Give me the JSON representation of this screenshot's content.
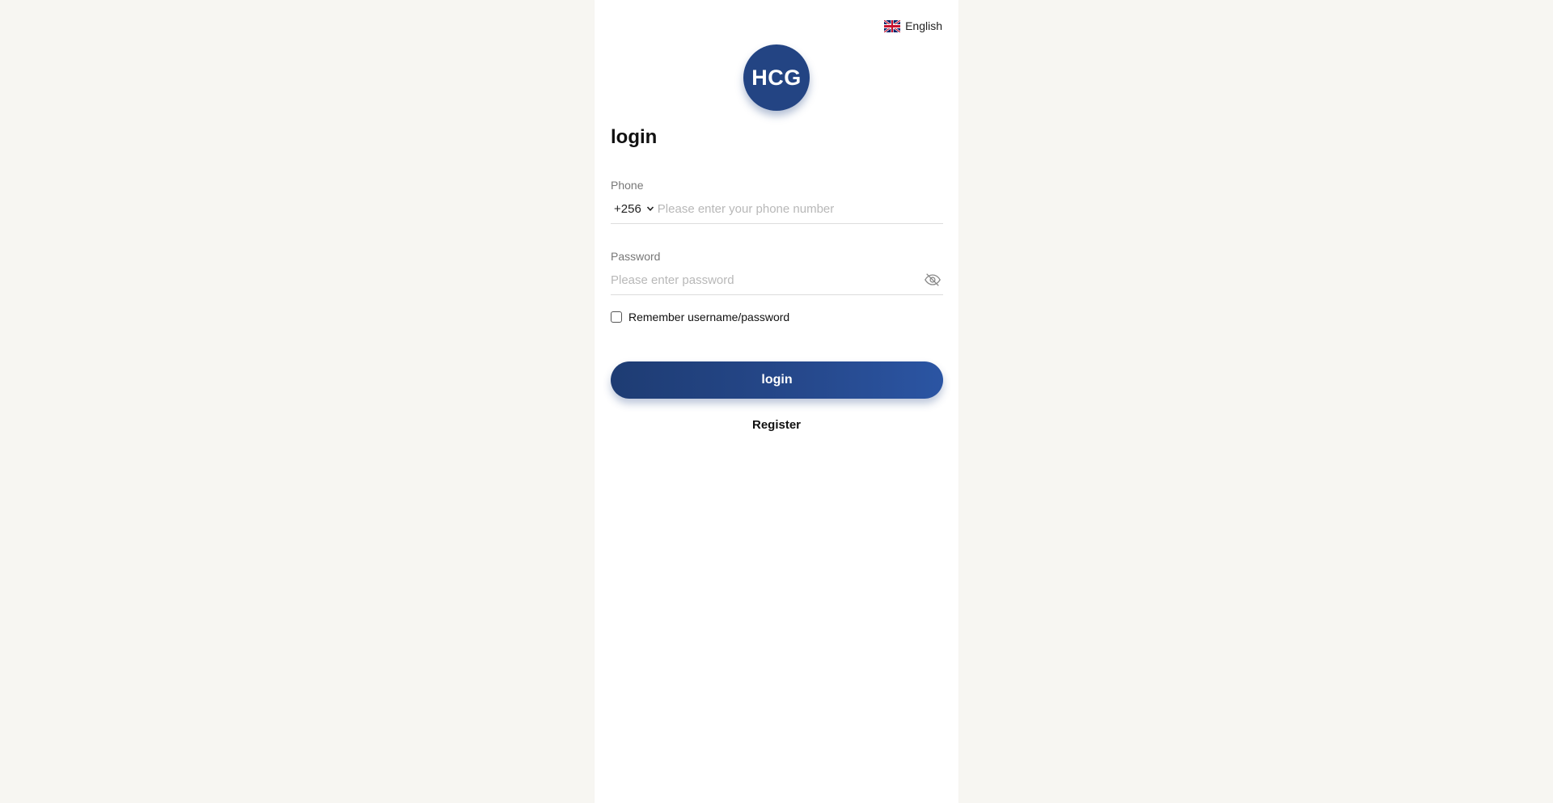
{
  "language": {
    "label": "English",
    "flag_icon": "uk-flag-icon"
  },
  "logo": {
    "text": "HCG",
    "color": "#234483"
  },
  "title": "login",
  "phone": {
    "label": "Phone",
    "country_code": "+256",
    "placeholder": "Please enter your phone number",
    "value": ""
  },
  "password": {
    "label": "Password",
    "placeholder": "Please enter password",
    "value": "",
    "toggle_icon": "eye-off-icon"
  },
  "remember": {
    "label": "Remember username/password",
    "checked": false
  },
  "login_button": {
    "label": "login",
    "color": "#26498d"
  },
  "register_link": {
    "label": "Register"
  }
}
